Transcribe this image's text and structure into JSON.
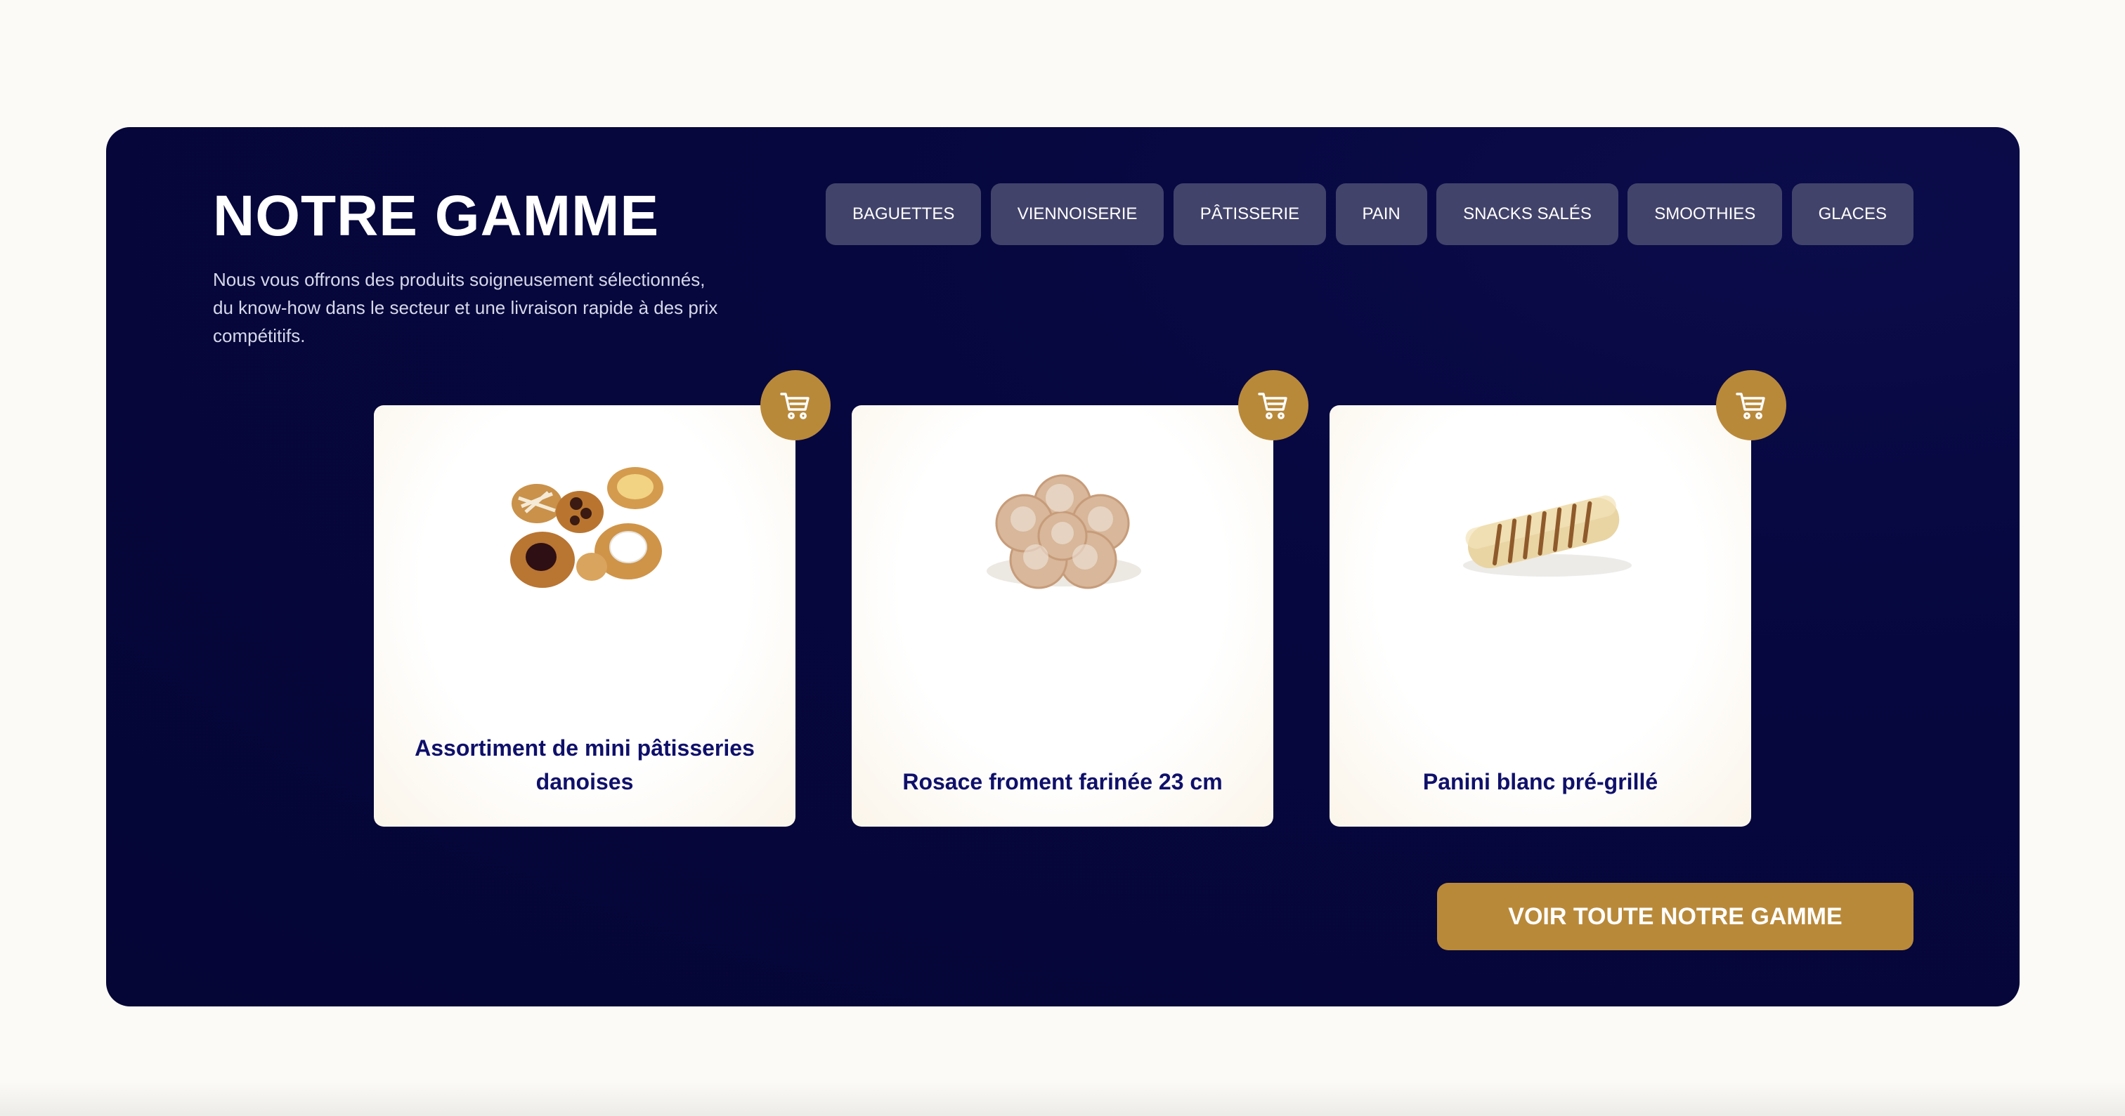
{
  "section": {
    "title": "NOTRE GAMME",
    "description": "Nous vous offrons des produits soigneusement sélectionnés, du know-how dans le secteur et une livraison rapide à des prix compétitifs."
  },
  "categories": [
    {
      "label": "BAGUETTES"
    },
    {
      "label": "VIENNOISERIE"
    },
    {
      "label": "PÂTISSERIE"
    },
    {
      "label": "PAIN"
    },
    {
      "label": "SNACKS SALÉS"
    },
    {
      "label": "SMOOTHIES"
    },
    {
      "label": "GLACES"
    }
  ],
  "products": [
    {
      "name": "Assortiment de mini pâtisseries danoises",
      "image": "mini-danish-pastries-photo",
      "cart_icon": "cart-icon"
    },
    {
      "name": "Rosace froment farinée 23 cm",
      "image": "floured-rosace-bread-photo",
      "cart_icon": "cart-icon"
    },
    {
      "name": "Panini blanc pré-grillé",
      "image": "pre-grilled-panini-photo",
      "cart_icon": "cart-icon"
    }
  ],
  "cta": {
    "label": "VOIR TOUTE NOTRE GAMME"
  },
  "colors": {
    "page_background": "#fbfaf6",
    "panel_background": "#06073e",
    "tab_background": "#42436a",
    "accent_gold": "#b9893a",
    "product_title": "#0f106a",
    "white": "#ffffff"
  }
}
